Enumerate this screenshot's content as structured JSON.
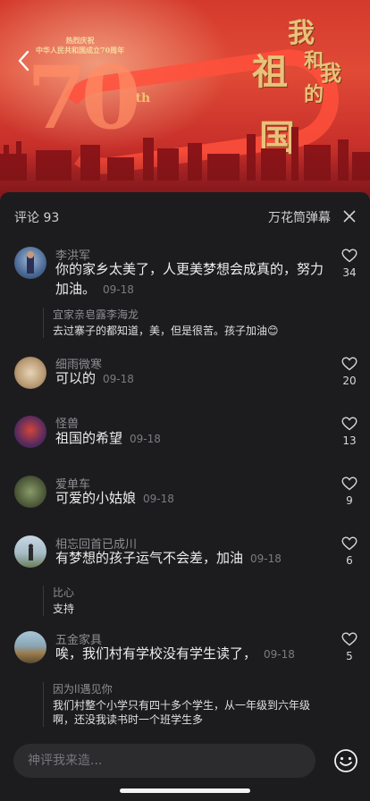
{
  "banner": {
    "caption_line1": "热烈庆祝",
    "caption_line2": "中华人民共和国成立70周年",
    "big_number": "70",
    "big_suffix": "th",
    "calligraphy": [
      "我",
      "和",
      "我",
      "的",
      "祖",
      "国"
    ]
  },
  "header": {
    "comment_label": "评论 93",
    "danmu_label": "万花筒弹幕"
  },
  "comments": [
    {
      "name": "李洪军",
      "text": "你的家乡太美了，人更美梦想会成真的，努力加油。",
      "date": "09-18",
      "likes": "34"
    },
    {
      "name": "细雨微寒",
      "text": "可以的",
      "date": "09-18",
      "likes": "20"
    },
    {
      "name": "怪兽",
      "text": "祖国的希望",
      "date": "09-18",
      "likes": "13"
    },
    {
      "name": "爱单车",
      "text": "可爱的小姑娘",
      "date": "09-18",
      "likes": "9"
    },
    {
      "name": "相忘回首已成川",
      "text": "有梦想的孩子运气不会差，加油",
      "date": "09-18",
      "likes": "6"
    },
    {
      "name": "五金家具",
      "text": "唉，我们村有学校没有学生读了，",
      "date": "09-18",
      "likes": "5"
    }
  ],
  "replies": [
    {
      "name": "宜家亲皂露李海龙",
      "text": "去过寨子的都知道，美，但是很苦。孩子加油😊"
    },
    {
      "name": "比心",
      "text": "支持"
    },
    {
      "name": "因为ll遇见你",
      "text": "我们村整个小学只有四十多个学生，从一年级到六年级啊，还没我读书时一个班学生多"
    }
  ],
  "input": {
    "placeholder": "神评我来造..."
  }
}
